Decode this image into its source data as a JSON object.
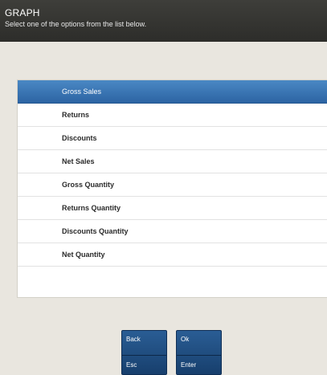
{
  "header": {
    "title": "GRAPH",
    "subtitle": "Select one of the options from the list below."
  },
  "list": {
    "selected_index": 0,
    "items": [
      {
        "label": "Gross Sales"
      },
      {
        "label": "Returns"
      },
      {
        "label": "Discounts"
      },
      {
        "label": "Net Sales"
      },
      {
        "label": "Gross Quantity"
      },
      {
        "label": "Returns Quantity"
      },
      {
        "label": "Discounts Quantity"
      },
      {
        "label": "Net Quantity"
      }
    ]
  },
  "keys": {
    "back": {
      "label": "Back",
      "hotkey": "Esc"
    },
    "ok": {
      "label": "Ok",
      "hotkey": "Enter"
    }
  },
  "colors": {
    "header_bg": "#353532",
    "selected_bg": "#3672b1",
    "key_bg": "#214d80",
    "background": "#e9e6df"
  }
}
